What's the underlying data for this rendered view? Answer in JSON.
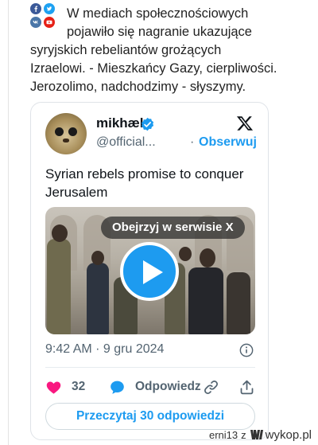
{
  "post": {
    "text_line1": "W mediach społecznościowych",
    "text_line2": "pojawiło się nagranie ukazujące",
    "text_line3": "syryjskich rebeliantów grożących",
    "text_line4": "Izraelowi. - Mieszkańcy Gazy, cierpliwości.",
    "text_line5": "Jerozolimo, nadchodzimy - słyszymy."
  },
  "share_icons": [
    "facebook-icon",
    "twitter-icon",
    "vk-icon",
    "youtube-icon"
  ],
  "tweet": {
    "author_name": "mikhæl",
    "author_handle": "@official...",
    "separator": "·",
    "follow_label": "Obserwuj",
    "text": "Syrian rebels promise to conquer Jerusalem",
    "video_watch_label": "Obejrzyj w serwisie X",
    "timestamp": "9:42 AM · 9 gru 2024",
    "like_count": "32",
    "reply_label": "Odpowiedz",
    "read_replies_label": "Przeczytaj 30 odpowiedzi"
  },
  "footer": {
    "user": "erni13",
    "separator": "z",
    "brand": "wykop.pl"
  },
  "colors": {
    "accent": "#1d9bf0",
    "like": "#f91880",
    "secondary_text": "#536471"
  }
}
